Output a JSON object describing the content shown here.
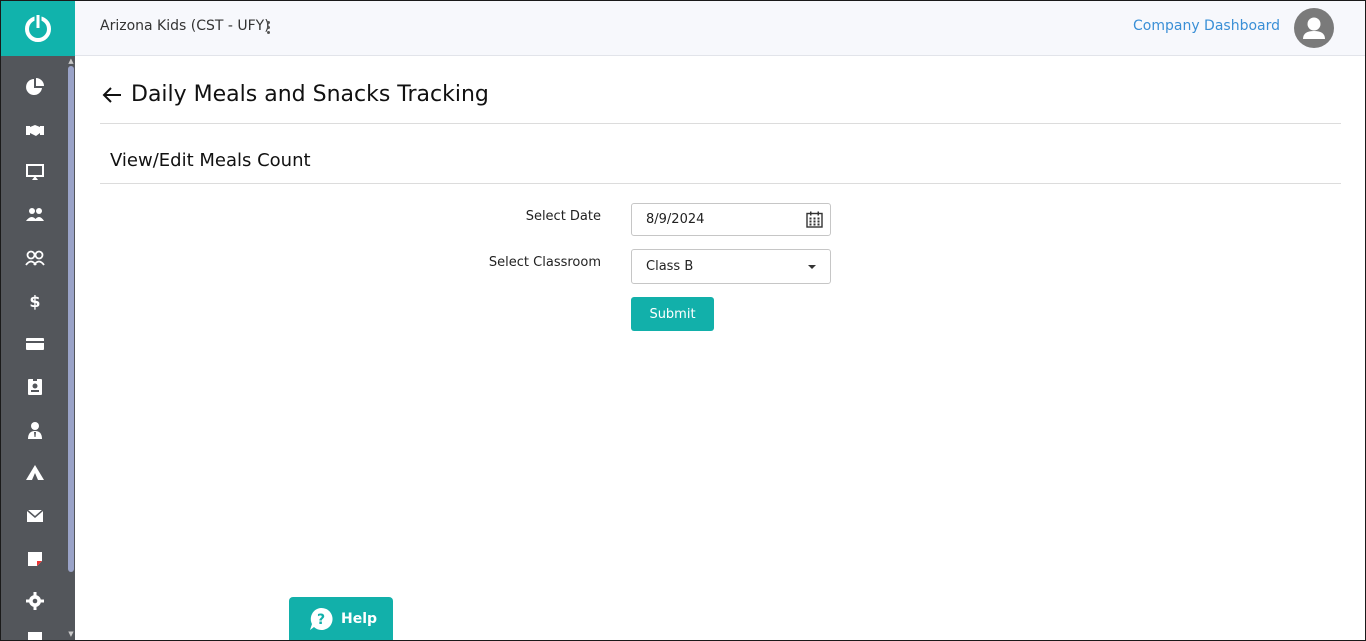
{
  "header": {
    "org_name": "Arizona Kids (CST - UFY)",
    "dashboard_link": "Company Dashboard"
  },
  "sidebar": {
    "items": [
      {
        "icon": "pie-chart-icon"
      },
      {
        "icon": "handshake-icon"
      },
      {
        "icon": "presentation-icon"
      },
      {
        "icon": "users-icon"
      },
      {
        "icon": "children-icon"
      },
      {
        "icon": "dollar-icon"
      },
      {
        "icon": "credit-card-icon"
      },
      {
        "icon": "id-badge-icon"
      },
      {
        "icon": "user-tie-icon"
      },
      {
        "icon": "campground-icon"
      },
      {
        "icon": "envelope-icon"
      },
      {
        "icon": "sticky-note-icon"
      },
      {
        "icon": "gear-icon"
      }
    ]
  },
  "page": {
    "title": "Daily Meals and Snacks Tracking",
    "section_title": "View/Edit Meals Count"
  },
  "form": {
    "date_label": "Select Date",
    "date_value": "8/9/2024",
    "classroom_label": "Select Classroom",
    "classroom_value": "Class B",
    "submit_label": "Submit"
  },
  "help": {
    "label": "Help"
  },
  "colors": {
    "accent": "#12b0aa",
    "sidebar": "#53565b",
    "link": "#3a8fd6"
  }
}
